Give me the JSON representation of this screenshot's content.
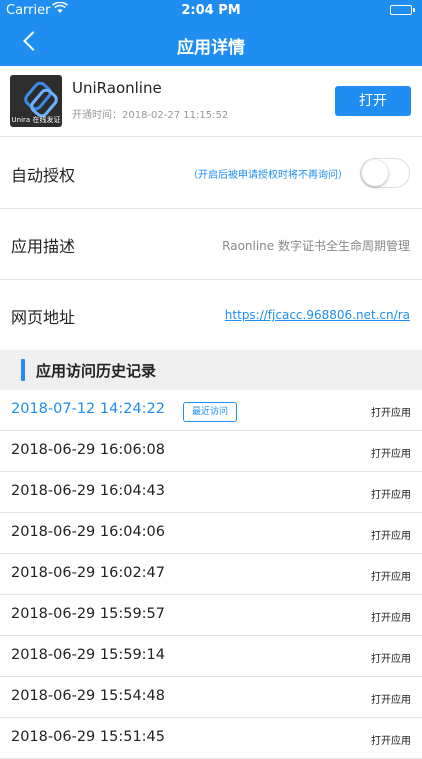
{
  "status_bar": {
    "carrier": "Carrier",
    "time": "2:04 PM",
    "battery_color": "#4cd964"
  },
  "nav": {
    "title": "应用详情",
    "back_icon": "chevron-left-icon"
  },
  "app": {
    "logo_caption": "Unira 在线发证",
    "name": "UniRaonline",
    "opened_at": "开通时间：2018-02-27 11:15:52",
    "open_label": "打开"
  },
  "settings": {
    "auto_auth_label": "自动授权",
    "auto_auth_hint": "（开启后被申请授权时将不再询问）",
    "auto_auth_on": false,
    "desc_label": "应用描述",
    "desc_value": "Raonline 数字证书全生命周期管理",
    "url_label": "网页地址",
    "url_value": "https://fjcacc.968806.net.cn/ra"
  },
  "history": {
    "title": "应用访问历史记录",
    "recent_badge": "最近访问",
    "open_label": "打开应用",
    "items": [
      "2018-07-12 14:24:22",
      "2018-06-29 16:06:08",
      "2018-06-29 16:04:43",
      "2018-06-29 16:04:06",
      "2018-06-29 16:02:47",
      "2018-06-29 15:59:57",
      "2018-06-29 15:59:14",
      "2018-06-29 15:54:48",
      "2018-06-29 15:51:45"
    ]
  },
  "colors": {
    "accent": "#1f8ef0"
  }
}
